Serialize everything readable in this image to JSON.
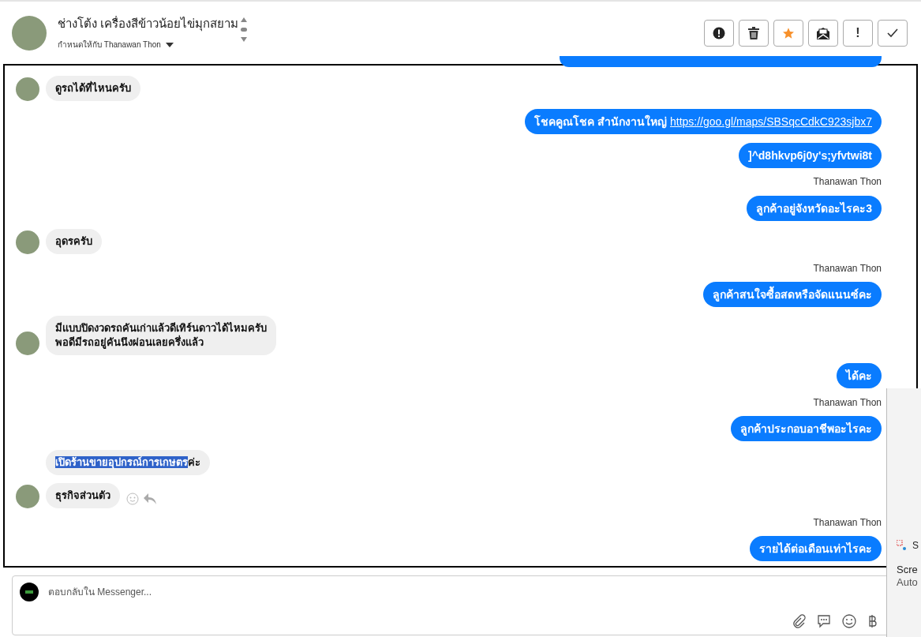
{
  "header": {
    "title": "ช่างโต้ง เครื่องสีข้าวน้อยไข่มุกสยาม",
    "assigned": "กำหนดให้กับ Thanawan Thon"
  },
  "actions": [
    {
      "kind": "alert"
    },
    {
      "kind": "trash"
    },
    {
      "kind": "star"
    },
    {
      "kind": "mail"
    },
    {
      "kind": "exclaim",
      "label": "!"
    },
    {
      "kind": "check"
    }
  ],
  "messages": [
    {
      "kind": "partial"
    },
    {
      "kind": "in",
      "text": "ดูรถได้ที่ไหนครับ",
      "avatar": true
    },
    {
      "kind": "out",
      "text": "โชคคูณโชค สำนักงานใหญ่ ",
      "link": "https://goo.gl/maps/SBSqcCdkC923sjbx7"
    },
    {
      "kind": "out",
      "text": "]^d8hkvp6j0y's;yfvtwi8t"
    },
    {
      "kind": "sender",
      "text": "Thanawan Thon"
    },
    {
      "kind": "out",
      "text": "ลูกค้าอยู่จังหวัดอะไรคะ3"
    },
    {
      "kind": "in",
      "text": "อุดรครับ",
      "avatar": true
    },
    {
      "kind": "sender",
      "text": "Thanawan Thon"
    },
    {
      "kind": "out",
      "text": "ลูกค้าสนใจซื้อสดหรือจัดแนนซ์คะ"
    },
    {
      "kind": "in",
      "text": "มีแบบปิดงวดรถคันเก่าแล้วดีเทิร์นดาวได้ไหมครับ\nพอดีมีรถอยู่คันนึงผ่อนเลยครึ่งแล้ว",
      "avatar": true
    },
    {
      "kind": "out",
      "text": "ได้คะ"
    },
    {
      "kind": "sender",
      "text": "Thanawan Thon"
    },
    {
      "kind": "out",
      "text": "ลูกค้าประกอบอาชีพอะไรคะ"
    },
    {
      "kind": "in",
      "highlighted": "เปิดร้านขายอุปกรณ์การเกษตร",
      "text": "ค่ะ",
      "avatar": false
    },
    {
      "kind": "in",
      "text": "ธุรกิจส่วนตัว",
      "avatar": true,
      "reactions": true
    },
    {
      "kind": "sender",
      "text": "Thanawan Thon"
    },
    {
      "kind": "out",
      "text": "รายได้ต่อเดือนเท่าไรคะ"
    }
  ],
  "composer": {
    "placeholder": "ตอบกลับใน Messenger..."
  },
  "notification": {
    "app": "S",
    "title": "Scre",
    "body": "Auto"
  }
}
